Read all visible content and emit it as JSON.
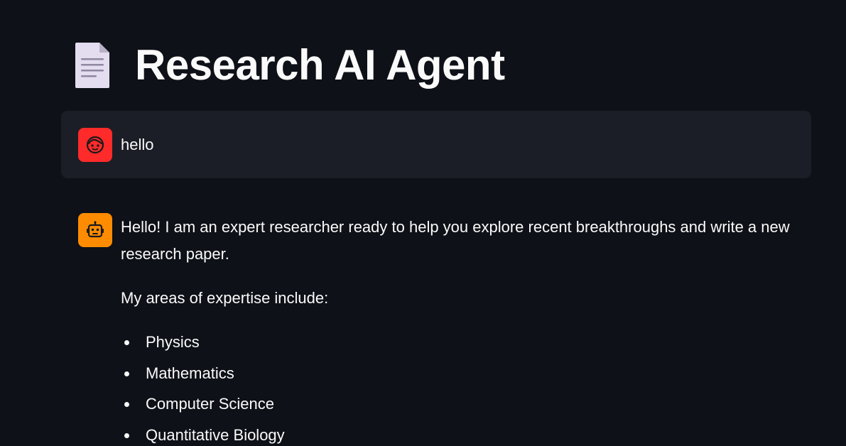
{
  "header": {
    "title": "Research AI Agent",
    "icon": "document-icon"
  },
  "colors": {
    "background": "#0e1117",
    "user_bubble": "#1b1e26",
    "user_avatar": "#ff2b2b",
    "assistant_avatar": "#ff8c00",
    "text": "#fafafa"
  },
  "chat": {
    "user_message": {
      "avatar_icon": "face-icon",
      "text": "hello"
    },
    "assistant_message": {
      "avatar_icon": "robot-icon",
      "intro": "Hello! I am an expert researcher ready to help you explore recent breakthroughs and write a new research paper.",
      "areas_heading": "My areas of expertise include:",
      "areas": [
        "Physics",
        "Mathematics",
        "Computer Science",
        "Quantitative Biology"
      ]
    }
  }
}
